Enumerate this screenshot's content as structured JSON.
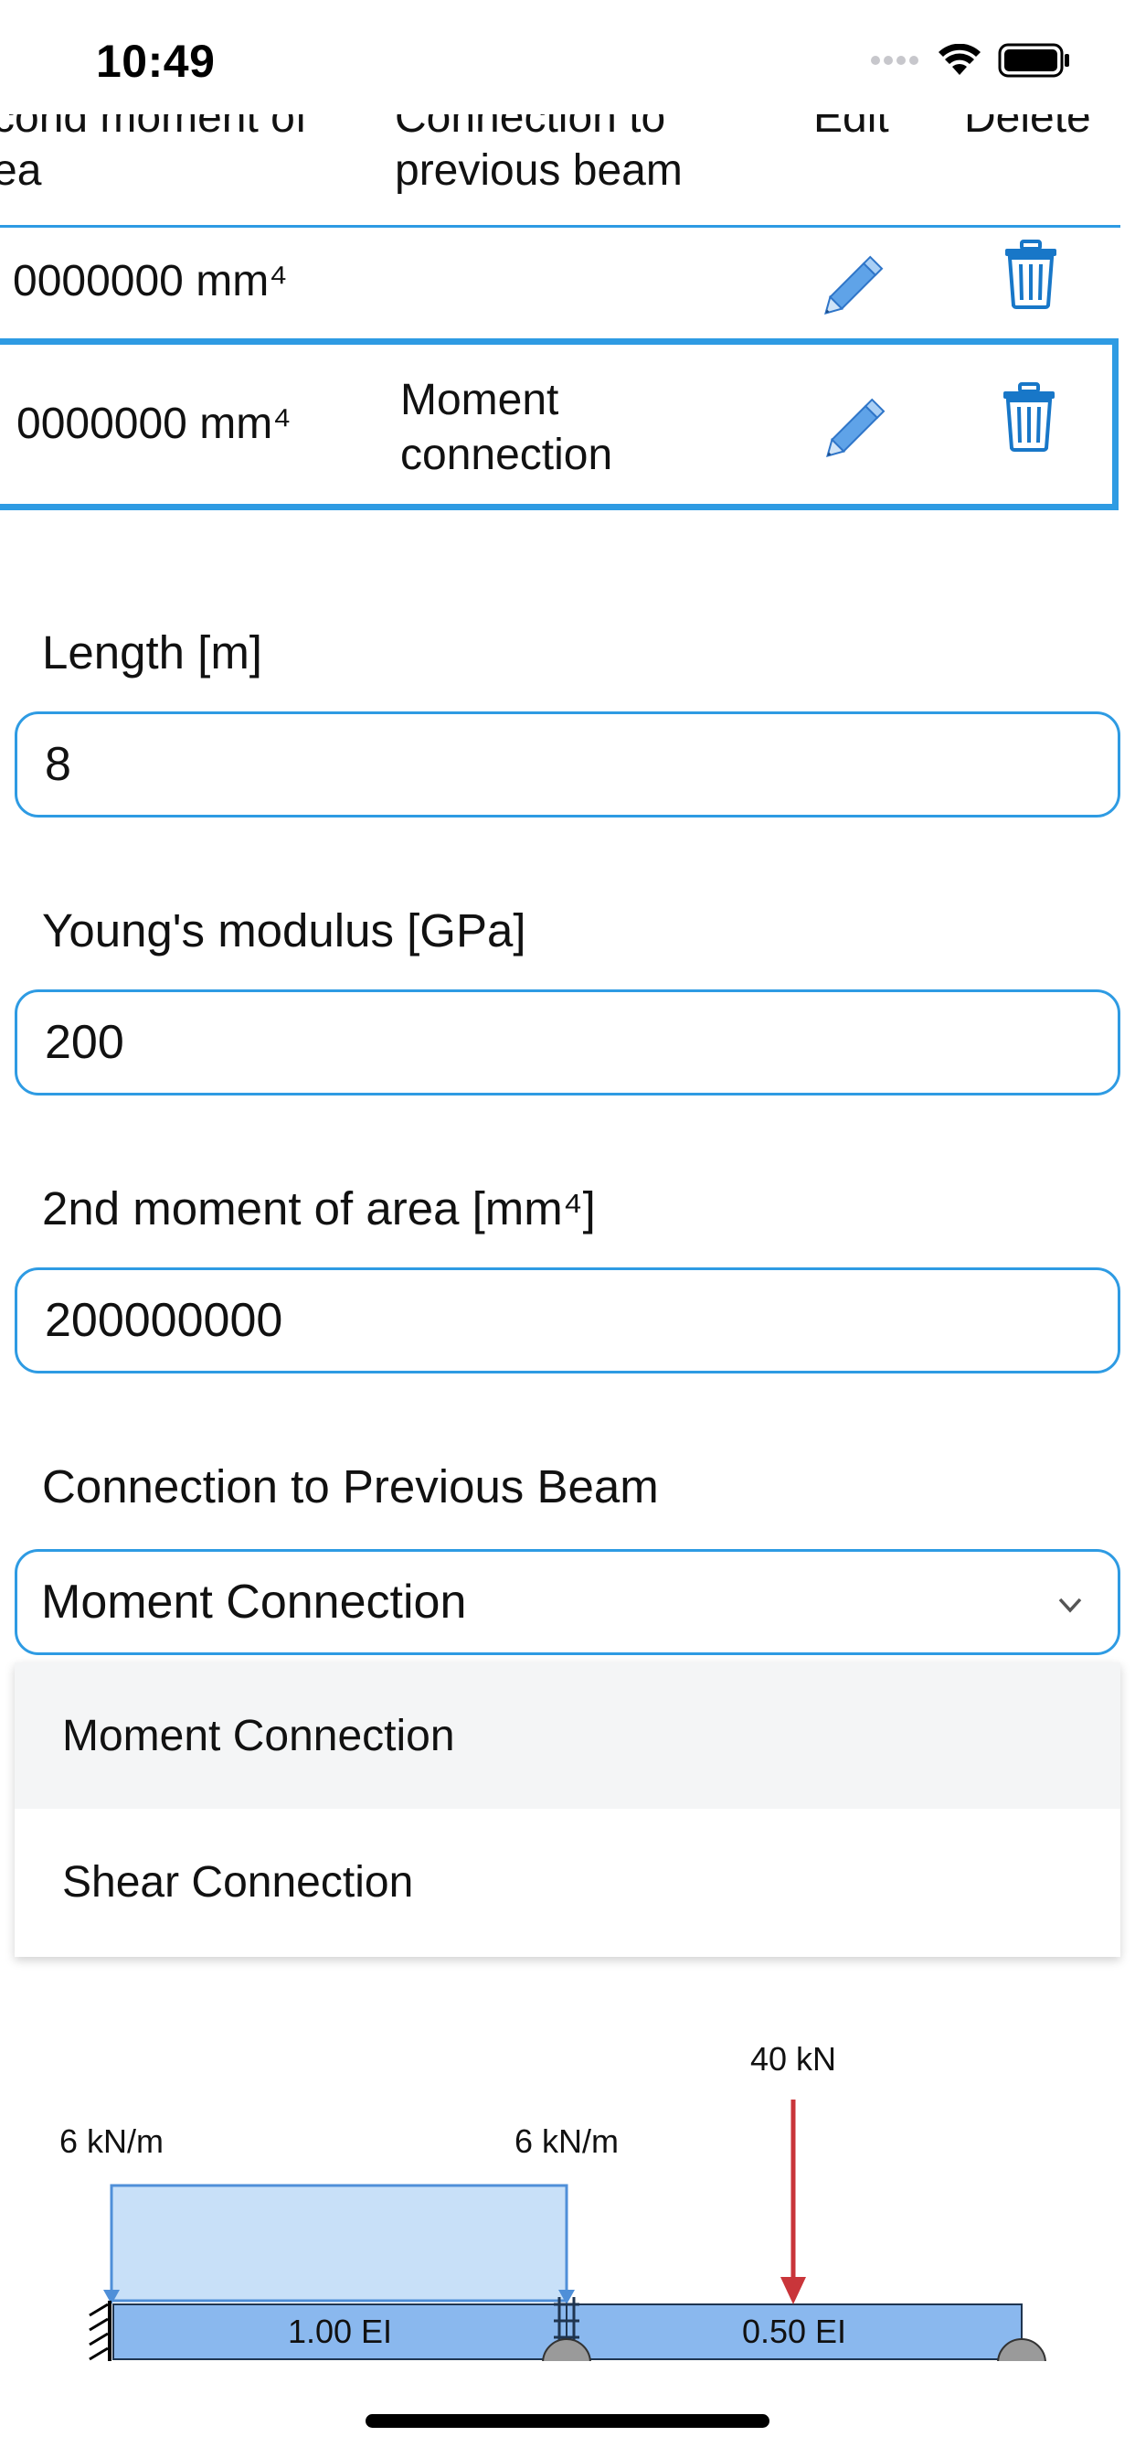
{
  "status_bar": {
    "time": "10:49"
  },
  "table": {
    "headers": {
      "second_moment": [
        "cond moment of",
        "ea"
      ],
      "connection": [
        "Connection to",
        "previous beam"
      ],
      "edit": "Edit",
      "delete": "Delete"
    },
    "rows": [
      {
        "second_moment": "0000000 mm⁴",
        "connection": [
          "",
          ""
        ]
      },
      {
        "second_moment": "0000000 mm⁴",
        "connection": [
          "Moment",
          "connection"
        ]
      }
    ]
  },
  "form": {
    "length_label": "Length [m]",
    "length_value": "8",
    "youngs_label": "Young's modulus [GPa]",
    "youngs_value": "200",
    "moment_label": "2nd moment of area [mm⁴]",
    "moment_value": "200000000",
    "connection_label": "Connection to Previous Beam",
    "connection_selected": "Moment Connection",
    "connection_options": [
      "Moment Connection",
      "Shear Connection"
    ]
  },
  "diagram": {
    "point_load_label": "40 kN",
    "udl_left_label": "6 kN/m",
    "udl_right_label": "6 kN/m",
    "segment_1_label": "1.00 EI",
    "segment_2_label": "0.50 EI"
  },
  "colors": {
    "accent": "#2e9be3",
    "beam_fill": "#8ab8ee",
    "udl_fill": "#c8e0f8",
    "udl_stroke": "#4f8fd8",
    "point_load": "#c9353a",
    "dropdown_highlight": "#f4f5f6"
  }
}
